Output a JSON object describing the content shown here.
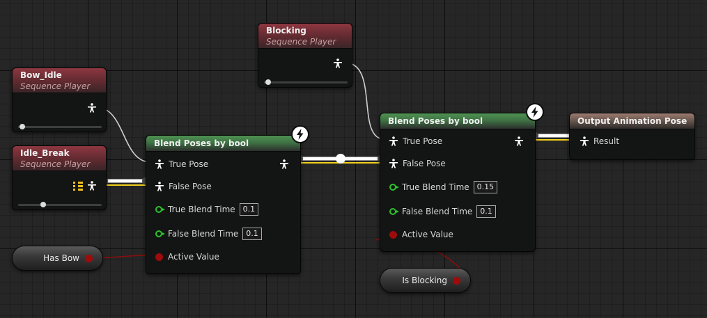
{
  "nodes": {
    "bow_idle": {
      "title": "Bow_Idle",
      "subtitle": "Sequence Player",
      "play_rate": 0.05
    },
    "idle_break": {
      "title": "Idle_Break",
      "subtitle": "Sequence Player",
      "play_rate": 0.3
    },
    "blocking": {
      "title": "Blocking",
      "subtitle": "Sequence Player",
      "play_rate": 0.05
    },
    "blend1": {
      "title": "Blend Poses by bool",
      "true_pose": "True Pose",
      "false_pose": "False Pose",
      "true_blend_time_label": "True Blend Time",
      "true_blend_time": "0.1",
      "false_blend_time_label": "False Blend Time",
      "false_blend_time": "0.1",
      "active_value": "Active Value"
    },
    "blend2": {
      "title": "Blend Poses by bool",
      "true_pose": "True Pose",
      "false_pose": "False Pose",
      "true_blend_time_label": "True Blend Time",
      "true_blend_time": "0.15",
      "false_blend_time_label": "False Blend Time",
      "false_blend_time": "0.1",
      "active_value": "Active Value"
    },
    "output": {
      "title": "Output Animation Pose",
      "result": "Result"
    },
    "has_bow": {
      "label": "Has Bow"
    },
    "is_blocking": {
      "label": "Is Blocking"
    }
  },
  "icons": {
    "pose": "pose-pin-icon",
    "fast_path": "lightning-bolt-icon",
    "cached_pose": "cached-pose-icon"
  },
  "colors": {
    "pose_wire": "#ffffff",
    "active_wire": "#f2d21b",
    "bool_pin": "#9e0b0b",
    "float_pin": "#2dc22d",
    "blend_header": "#4f9152",
    "sequence_header": "#8e3740"
  }
}
